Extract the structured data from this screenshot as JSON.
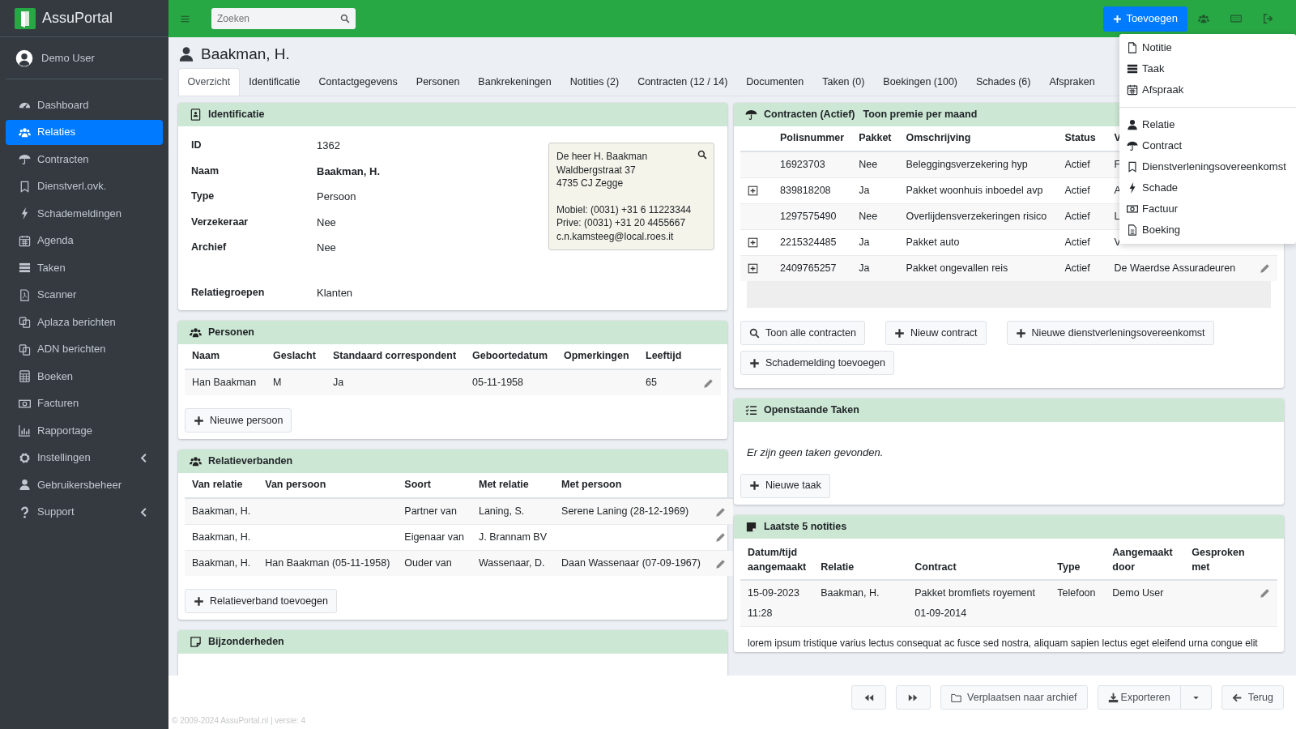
{
  "brand": "AssuPortal",
  "user": "Demo User",
  "sidebar": {
    "items": [
      {
        "label": "Dashboard",
        "selected": false,
        "submenu": false
      },
      {
        "label": "Relaties",
        "selected": true,
        "submenu": false
      },
      {
        "label": "Contracten",
        "selected": false,
        "submenu": false
      },
      {
        "label": "Dienstverl.ovk.",
        "selected": false,
        "submenu": false
      },
      {
        "label": "Schademeldingen",
        "selected": false,
        "submenu": false
      },
      {
        "label": "Agenda",
        "selected": false,
        "submenu": false
      },
      {
        "label": "Taken",
        "selected": false,
        "submenu": false
      },
      {
        "label": "Scanner",
        "selected": false,
        "submenu": false
      },
      {
        "label": "Aplaza berichten",
        "selected": false,
        "submenu": false
      },
      {
        "label": "ADN berichten",
        "selected": false,
        "submenu": false
      },
      {
        "label": "Boeken",
        "selected": false,
        "submenu": false
      },
      {
        "label": "Facturen",
        "selected": false,
        "submenu": false
      },
      {
        "label": "Rapportage",
        "selected": false,
        "submenu": false
      },
      {
        "label": "Instellingen",
        "selected": false,
        "submenu": true
      },
      {
        "label": "Gebruikersbeheer",
        "selected": false,
        "submenu": false
      },
      {
        "label": "Support",
        "selected": false,
        "submenu": true
      }
    ]
  },
  "search": {
    "placeholder": "Zoeken"
  },
  "add_button": "Toevoegen",
  "add_menu": {
    "groups": [
      [
        "Notitie",
        "Taak",
        "Afspraak"
      ],
      [
        "Relatie",
        "Contract",
        "Dienstverleningsovereenkomst",
        "Schade",
        "Factuur",
        "Boeking"
      ]
    ]
  },
  "page_title": "Baakman, H.",
  "tabs": [
    {
      "label": "Overzicht",
      "selected": true
    },
    {
      "label": "Identificatie",
      "selected": false
    },
    {
      "label": "Contactgegevens",
      "selected": false
    },
    {
      "label": "Personen",
      "selected": false
    },
    {
      "label": "Bankrekeningen",
      "selected": false
    },
    {
      "label": "Notities (2)",
      "selected": false
    },
    {
      "label": "Contracten (12 / 14)",
      "selected": false
    },
    {
      "label": "Documenten",
      "selected": false
    },
    {
      "label": "Taken (0)",
      "selected": false
    },
    {
      "label": "Boekingen (100)",
      "selected": false
    },
    {
      "label": "Schades (6)",
      "selected": false
    },
    {
      "label": "Afspraken",
      "selected": false
    }
  ],
  "identificatie": {
    "title": "Identificatie",
    "fields": [
      {
        "label": "ID",
        "value": "1362",
        "bold": false
      },
      {
        "label": "Naam",
        "value": "Baakman, H.",
        "bold": true
      },
      {
        "label": "Type",
        "value": "Persoon",
        "bold": false
      },
      {
        "label": "Verzekeraar",
        "value": "Nee",
        "bold": false
      },
      {
        "label": "Archief",
        "value": "Nee",
        "bold": false
      }
    ],
    "extra_fields": [
      {
        "label": "Relatiegroepen",
        "value": "Klanten",
        "bold": false
      }
    ],
    "address": [
      "De heer H. Baakman",
      "Waldbergstraat 37",
      "4735 CJ Zegge"
    ],
    "contact": [
      "Mobiel: (0031) +31 6 11223344",
      "Prive: (0031) +31 20 4455667",
      "c.n.kamsteeg@local.roes.it"
    ]
  },
  "personen": {
    "title": "Personen",
    "columns": [
      "Naam",
      "Geslacht",
      "Standaard correspondent",
      "Geboortedatum",
      "Opmerkingen",
      "Leeftijd"
    ],
    "rows": [
      [
        "Han Baakman",
        "M",
        "Ja",
        "05-11-1958",
        null,
        "65"
      ]
    ],
    "button": "Nieuwe persoon"
  },
  "relatieverbanden": {
    "title": "Relatieverbanden",
    "columns": [
      "Van relatie",
      "Van persoon",
      "Soort",
      "Met relatie",
      "Met persoon"
    ],
    "rows": [
      [
        "Baakman, H.",
        null,
        "Partner van",
        "Laning, S.",
        "Serene Laning (28-12-1969)"
      ],
      [
        "Baakman, H.",
        null,
        "Eigenaar van",
        "J. Brannam BV",
        null
      ],
      [
        "Baakman, H.",
        "Han Baakman (05-11-1958)",
        "Ouder van",
        "Wassenaar, D.",
        "Daan Wassenaar (07-09-1967)"
      ]
    ],
    "button": "Relatieverband toevoegen"
  },
  "bijzonderheden": {
    "title": "Bijzonderheden"
  },
  "contracten": {
    "title": "Contracten (Actief)",
    "link": "Toon premie per maand",
    "columns": [
      "Polisnummer",
      "Pakket",
      "Omschrijving",
      "Status",
      "V"
    ],
    "rows": [
      {
        "expandable": false,
        "edit": false,
        "cells": [
          "16923703",
          "Nee",
          "Beleggingsverzekering hyp",
          "Actief",
          "F"
        ]
      },
      {
        "expandable": true,
        "edit": false,
        "cells": [
          "839818208",
          "Ja",
          "Pakket woonhuis inboedel avp",
          "Actief",
          "A"
        ]
      },
      {
        "expandable": false,
        "edit": false,
        "cells": [
          "1297575490",
          "Nee",
          "Overlijdensverzekeringen risico",
          "Actief",
          "L"
        ]
      },
      {
        "expandable": true,
        "edit": false,
        "cells": [
          "2215324485",
          "Ja",
          "Pakket auto",
          "Actief",
          "V"
        ]
      },
      {
        "expandable": true,
        "edit": true,
        "cells": [
          "2409765257",
          "Ja",
          "Pakket ongevallen reis",
          "Actief",
          "De Waerdse Assuradeuren"
        ]
      }
    ],
    "buttons": [
      "Toon alle contracten",
      "Nieuw contract",
      "Nieuwe dienstverleningsovereenkomst",
      "Schademelding toevoegen"
    ]
  },
  "taken": {
    "title": "Openstaande Taken",
    "empty": "Er zijn geen taken gevonden.",
    "button": "Nieuwe taak"
  },
  "notities": {
    "title": "Laatste 5 notities",
    "columns": [
      "Datum/tijd aangemaakt",
      "Relatie",
      "Contract",
      "Type",
      "Aangemaakt door",
      "Gesproken met"
    ],
    "rows": [
      {
        "cells": [
          "15-09-2023 11:28",
          "Baakman, H.",
          "Pakket bromfiets royement 01-09-2014",
          "Telefoon",
          "Demo User",
          null
        ],
        "text": "lorem ipsum tristique varius lectus consequat ac fusce sed nostra, aliquam sapien lectus eget eleifend urna congue elit"
      }
    ]
  },
  "footer": {
    "archive": "Verplaatsen naar archief",
    "export": "Exporteren",
    "back": "Terug",
    "copyright": "© 2009-2024 AssuPortal.nl | versie: 4"
  }
}
